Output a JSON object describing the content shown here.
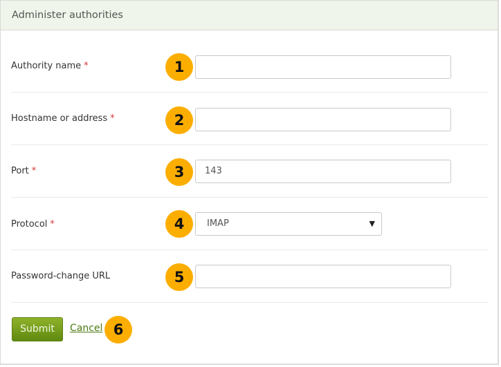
{
  "panel": {
    "title": "Administer authorities"
  },
  "form": {
    "required_marker": "*",
    "fields": [
      {
        "label": "Authority name",
        "required": true,
        "badge": "1",
        "value": ""
      },
      {
        "label": "Hostname or address",
        "required": true,
        "badge": "2",
        "value": ""
      },
      {
        "label": "Port",
        "required": true,
        "badge": "3",
        "value": "143"
      },
      {
        "label": "Protocol",
        "required": true,
        "badge": "4",
        "value": "IMAP",
        "type": "select",
        "caret": "▼"
      },
      {
        "label": "Password-change URL",
        "required": false,
        "badge": "5",
        "value": ""
      }
    ],
    "submit_label": "Submit",
    "cancel_label": "Cancel",
    "actions_badge": "6"
  },
  "colors": {
    "header_bg": "#eff5ea",
    "badge": "#fcae00",
    "submit": "#6f9a18",
    "required": "#d9383a",
    "link": "#4d7a12"
  }
}
